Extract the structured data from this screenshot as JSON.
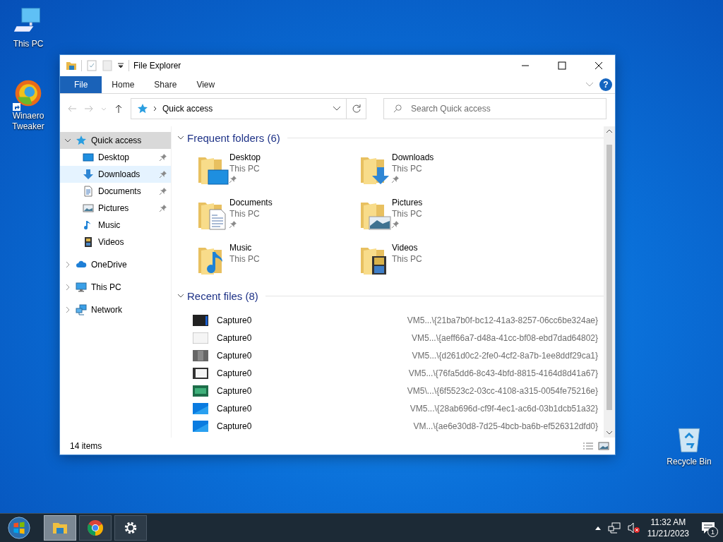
{
  "desktop_icons": [
    {
      "kind": "pc",
      "label": "This PC",
      "shortcut": false
    },
    {
      "kind": "tweaker",
      "label": "Winaero Tweaker",
      "shortcut": true
    },
    {
      "kind": "recycle",
      "label": "Recycle Bin",
      "shortcut": false
    }
  ],
  "window": {
    "title": "File Explorer",
    "ribbon_tabs": [
      {
        "label": "File",
        "kind": "file",
        "selected": false
      },
      {
        "label": "Home",
        "kind": "tab",
        "selected": false
      },
      {
        "label": "Share",
        "kind": "tab",
        "selected": false
      },
      {
        "label": "View",
        "kind": "tab",
        "selected": false
      }
    ],
    "help_button": "?",
    "address": {
      "location": "Quick access"
    },
    "search": {
      "placeholder": "Search Quick access"
    },
    "navigation": [
      {
        "label": "Quick access",
        "kind": "star",
        "expanded": true,
        "selected": true,
        "hovered": false,
        "children": [
          {
            "label": "Desktop",
            "kind": "desktop",
            "pinned": true,
            "selected": false,
            "hovered": false
          },
          {
            "label": "Downloads",
            "kind": "download",
            "pinned": true,
            "selected": false,
            "hovered": true
          },
          {
            "label": "Documents",
            "kind": "document",
            "pinned": true,
            "selected": false,
            "hovered": false
          },
          {
            "label": "Pictures",
            "kind": "pictures",
            "pinned": true,
            "selected": false,
            "hovered": false
          },
          {
            "label": "Music",
            "kind": "music",
            "pinned": false,
            "selected": false,
            "hovered": false
          },
          {
            "label": "Videos",
            "kind": "video",
            "pinned": false,
            "selected": false,
            "hovered": false
          }
        ]
      },
      {
        "label": "OneDrive",
        "kind": "cloud",
        "expanded": false,
        "selected": false,
        "hovered": false
      },
      {
        "label": "This PC",
        "kind": "pc",
        "expanded": false,
        "selected": false,
        "hovered": false
      },
      {
        "label": "Network",
        "kind": "network",
        "expanded": false,
        "selected": false,
        "hovered": false
      }
    ],
    "frequent_folders": {
      "heading": "Frequent folders (6)",
      "expanded": true,
      "items": [
        {
          "name": "Desktop",
          "location": "This PC",
          "kind": "desktop",
          "pinned": true
        },
        {
          "name": "Downloads",
          "location": "This PC",
          "kind": "download",
          "pinned": true
        },
        {
          "name": "Documents",
          "location": "This PC",
          "kind": "document",
          "pinned": true
        },
        {
          "name": "Pictures",
          "location": "This PC",
          "kind": "pictures",
          "pinned": true
        },
        {
          "name": "Music",
          "location": "This PC",
          "kind": "music",
          "pinned": false
        },
        {
          "name": "Videos",
          "location": "This PC",
          "kind": "video",
          "pinned": false
        }
      ]
    },
    "recent_files": {
      "heading": "Recent files (8)",
      "expanded": true,
      "items": [
        {
          "name": "Capture0",
          "path": "VM5...\\{21ba7b0f-bc12-41a3-8257-06cc6be324ae}",
          "kind": "dark"
        },
        {
          "name": "Capture0",
          "path": "VM5...\\{aeff66a7-d48a-41cc-bf08-ebd7dad64802}",
          "kind": "white"
        },
        {
          "name": "Capture0",
          "path": "VM5...\\{d261d0c2-2fe0-4cf2-8a7b-1ee8ddf29ca1}",
          "kind": "grey"
        },
        {
          "name": "Capture0",
          "path": "VM5...\\{76fa5dd6-8c43-4bfd-8815-4164d8d41a67}",
          "kind": "frame"
        },
        {
          "name": "Capture0",
          "path": "VM5\\...\\{6f5523c2-03cc-4108-a315-0054fe75216e}",
          "kind": "green"
        },
        {
          "name": "Capture0",
          "path": "VM5...\\{28ab696d-cf9f-4ec1-ac6d-03b1dcb51a32}",
          "kind": "blue"
        },
        {
          "name": "Capture0",
          "path": "VM...\\{ae6e30d8-7d25-4bcb-ba6b-ef526312dfd0}",
          "kind": "blue"
        }
      ]
    },
    "status_bar": {
      "item_count": "14 items"
    }
  },
  "taskbar": {
    "apps": [
      {
        "kind": "explorer",
        "active": true
      },
      {
        "kind": "chrome",
        "active": false
      },
      {
        "kind": "settings",
        "active": false
      }
    ],
    "clock": {
      "time": "11:32 AM",
      "date": "11/21/2023"
    },
    "volume_muted": true,
    "notification_count": "1"
  }
}
